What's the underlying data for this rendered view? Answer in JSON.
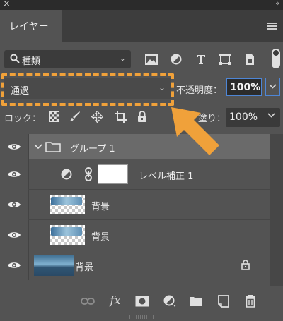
{
  "window": {
    "close_glyph": "×",
    "collapse_glyph": "‹‹"
  },
  "tab": {
    "label": "レイヤー"
  },
  "filter": {
    "label": "種類",
    "chevron": "⌄"
  },
  "filter_icons": [
    "image-filter-icon",
    "adjustment-filter-icon",
    "type-filter-icon",
    "shape-filter-icon",
    "smart-object-filter-icon"
  ],
  "blend_mode": {
    "value": "通過",
    "chevron": "⌄"
  },
  "opacity": {
    "label": "不透明度：",
    "value": "100%"
  },
  "lock": {
    "label": "ロック："
  },
  "fill": {
    "label": "塗り：",
    "value": "100%"
  },
  "layers": [
    {
      "name": "グループ 1",
      "type": "group",
      "visible": true,
      "selected": true
    },
    {
      "name": "レベル補正 1",
      "type": "adjustment",
      "visible": true
    },
    {
      "name": "背景",
      "type": "pixel-copy",
      "visible": true
    },
    {
      "name": "背景",
      "type": "pixel-copy",
      "visible": true
    },
    {
      "name": "背景",
      "type": "background",
      "visible": true,
      "locked": true
    }
  ],
  "bottom_toolbar": {
    "fx_label": "fx"
  },
  "colors": {
    "highlight_dash": "#f0a13a",
    "arrow": "#f0a13a",
    "focus_blue": "#4e86d6",
    "panel_bg": "#535353"
  }
}
